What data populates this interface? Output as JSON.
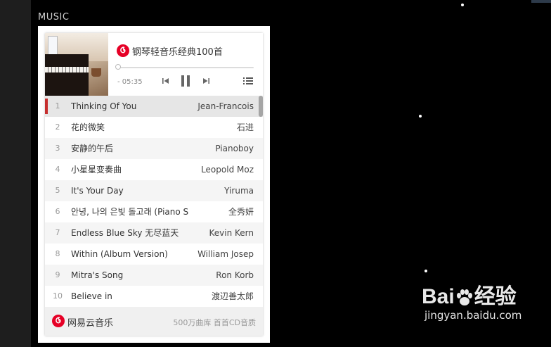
{
  "section_label": "MUSIC",
  "player": {
    "title": "钢琴轻音乐经典100首",
    "time": "- 05:35",
    "progress": 0.0,
    "accent_color": "#c62f2f",
    "icons": [
      "netease-music-logo-icon",
      "previous-icon",
      "pause-icon",
      "next-icon",
      "playlist-icon"
    ],
    "active_index": 0,
    "tracks": [
      {
        "num": "1",
        "name": "Thinking Of You",
        "artist": "Jean-Francois"
      },
      {
        "num": "2",
        "name": "花的微笑",
        "artist": "石进"
      },
      {
        "num": "3",
        "name": "安静的午后",
        "artist": "Pianoboy"
      },
      {
        "num": "4",
        "name": "小星星变奏曲",
        "artist": "Leopold Moz"
      },
      {
        "num": "5",
        "name": "It's Your Day",
        "artist": "Yiruma"
      },
      {
        "num": "6",
        "name": "안녕, 나의 은빛 돌고래 (Piano S",
        "artist": "全秀妍"
      },
      {
        "num": "7",
        "name": "Endless Blue Sky 无尽蓝天",
        "artist": "Kevin Kern"
      },
      {
        "num": "8",
        "name": "Within (Album Version)",
        "artist": "William Josep"
      },
      {
        "num": "9",
        "name": "Mitra's Song",
        "artist": "Ron Korb"
      },
      {
        "num": "10",
        "name": "Believe in",
        "artist": "渡辺善太郎"
      }
    ],
    "footer": {
      "brand": "网易云音乐",
      "slogan": "500万曲库 首首CD音质"
    }
  },
  "watermark": {
    "top": "Bai",
    "top_suffix": "经验",
    "bottom": "jingyan.baidu.com"
  }
}
